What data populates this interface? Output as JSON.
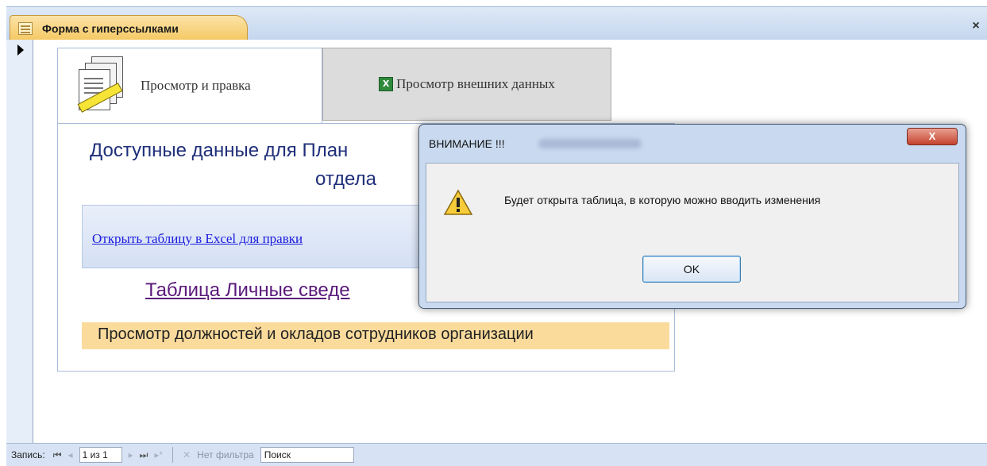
{
  "document_tab": {
    "title": "Форма с гиперссылками",
    "close_label": "×"
  },
  "form": {
    "tabs": [
      {
        "label": "Просмотр и правка"
      },
      {
        "label": "Просмотр внешних данных",
        "icon_glyph": "X"
      }
    ],
    "heading_line1": "Доступные данные для План",
    "heading_line2": "отдела",
    "excel_link": "Открыть таблицу в Excel для правки",
    "personal_link": "Таблица Личные сведе",
    "positions_text": "Просмотр должностей и окладов сотрудников организации"
  },
  "dialog": {
    "title": "ВНИМАНИЕ !!!",
    "close_label": "X",
    "message": "Будет открыта таблица, в которую можно вводить изменения",
    "ok_label": "OK"
  },
  "status_bar": {
    "record_label": "Запись:",
    "first_glyph": "⏮",
    "prev_glyph": "◂",
    "record_value": "1 из 1",
    "next_glyph": "▸",
    "last_glyph": "⏭",
    "new_glyph": "▸*",
    "filter_glyph": "✕",
    "filter_label": "Нет фильтра",
    "search_label": "Поиск"
  },
  "colors": {
    "accent_tab": "#f5c862",
    "link_blue": "#1b1bdd",
    "heading_blue": "#1f2f7a",
    "personal_purple": "#5a1a7a",
    "positions_bg": "#fbdb9c"
  },
  "icons": [
    "form-icon",
    "close-icon",
    "record-selector-icon",
    "document-edit-icon",
    "excel-icon",
    "warning-icon"
  ]
}
